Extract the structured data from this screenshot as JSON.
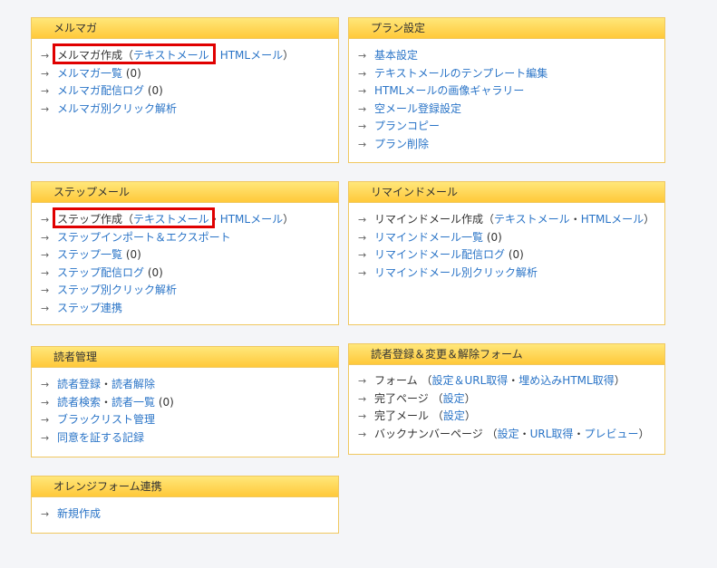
{
  "panels": {
    "mailmag": {
      "title": "メルマガ",
      "create_label": "メルマガ作成",
      "open_paren": "（",
      "text_mail": "テキストメール",
      "dot": "・",
      "html_mail": "HTMLメール",
      "close_paren": "）",
      "list_label": "メルマガ一覧",
      "list_count": " (0)",
      "log_label": "メルマガ配信ログ",
      "log_count": " (0)",
      "click_label": "メルマガ別クリック解析"
    },
    "plan": {
      "title": "プラン設定",
      "items": [
        "基本設定",
        "テキストメールのテンプレート編集",
        "HTMLメールの画像ギャラリー",
        "空メール登録設定",
        "プランコピー",
        "プラン削除"
      ]
    },
    "step": {
      "title": "ステップメール",
      "create_label": "ステップ作成",
      "open_paren": "（",
      "text_mail": "テキストメール",
      "dot": "・",
      "html_mail": "HTMLメール",
      "close_paren": "）",
      "import_label": "ステップインポート＆エクスポート",
      "list_label": "ステップ一覧",
      "list_count": " (0)",
      "log_label": "ステップ配信ログ",
      "log_count": " (0)",
      "click_label": "ステップ別クリック解析",
      "link_label": "ステップ連携"
    },
    "remind": {
      "title": "リマインドメール",
      "create_label": "リマインドメール作成",
      "open_paren": "（",
      "text_mail": "テキストメール",
      "dot": "・",
      "html_mail": "HTMLメール",
      "close_paren": "）",
      "list_label": "リマインドメール一覧",
      "list_count": " (0)",
      "log_label": "リマインドメール配信ログ",
      "log_count": " (0)",
      "click_label": "リマインドメール別クリック解析"
    },
    "reader": {
      "title": "読者管理",
      "register": "読者登録",
      "dot": "・",
      "unsubscribe": "読者解除",
      "search": "読者検索",
      "list": "読者一覧",
      "list_count": " (0)",
      "blacklist": "ブラックリスト管理",
      "consent": "同意を証する記録"
    },
    "forms": {
      "title": "読者登録＆変更＆解除フォーム",
      "form_label": "フォーム",
      "form_open": " （",
      "form_settings": "設定＆URL取得",
      "dot": "・",
      "form_embed": "埋め込みHTML取得",
      "close_paren": "）",
      "complete_label": "完了ページ",
      "complete_settings": "設定",
      "complete_mail_label": "完了メール",
      "complete_mail_settings": "設定",
      "backnumber_label": "バックナンバーページ",
      "bn_settings": "設定",
      "bn_url": "URL取得",
      "bn_preview": "プレビュー"
    },
    "orange": {
      "title": "オレンジフォーム連携",
      "new_label": "新規作成"
    }
  },
  "colors": {
    "link": "#2a74c7",
    "header_top": "#ffe77a",
    "header_bottom": "#ffc93a",
    "border": "#f0c860",
    "highlight": "#e00000"
  },
  "icons": {
    "bullet": "→"
  }
}
